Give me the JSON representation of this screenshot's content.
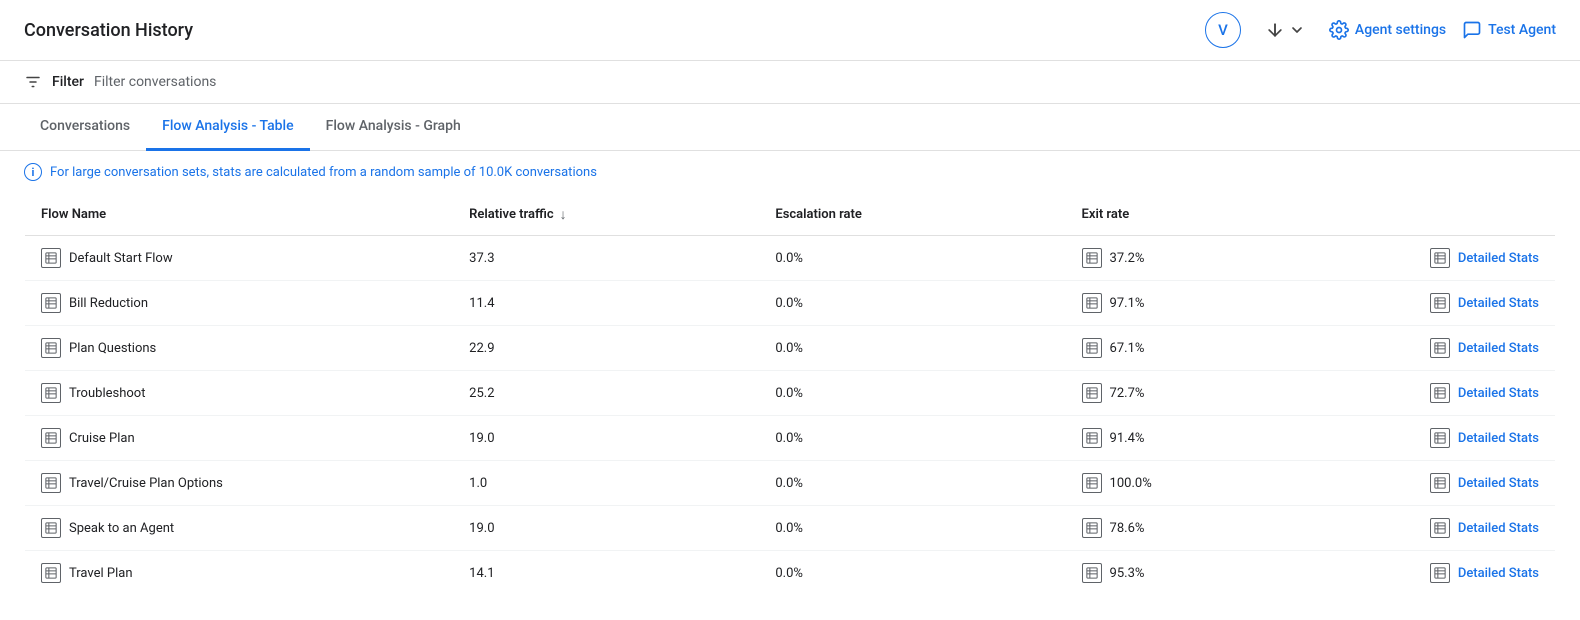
{
  "header": {
    "title": "Conversation History",
    "avatar_label": "V",
    "sort_label": "",
    "agent_settings_label": "Agent settings",
    "test_agent_label": "Test Agent"
  },
  "filter_bar": {
    "filter_label": "Filter",
    "filter_placeholder": "Filter conversations"
  },
  "tabs": [
    {
      "id": "conversations",
      "label": "Conversations",
      "active": false
    },
    {
      "id": "flow-table",
      "label": "Flow Analysis - Table",
      "active": true
    },
    {
      "id": "flow-graph",
      "label": "Flow Analysis - Graph",
      "active": false
    }
  ],
  "info_banner": {
    "text": "For large conversation sets, stats are calculated from a random sample of 10.0K conversations"
  },
  "table": {
    "columns": [
      {
        "id": "flow-name",
        "label": "Flow Name",
        "sortable": false
      },
      {
        "id": "relative-traffic",
        "label": "Relative traffic",
        "sortable": true
      },
      {
        "id": "escalation-rate",
        "label": "Escalation rate",
        "sortable": false
      },
      {
        "id": "exit-rate",
        "label": "Exit rate",
        "sortable": false
      },
      {
        "id": "action",
        "label": "",
        "sortable": false
      }
    ],
    "rows": [
      {
        "flow_name": "Default Start Flow",
        "relative_traffic": "37.3",
        "escalation_rate": "0.0%",
        "exit_rate": "37.2%",
        "action": "Detailed Stats"
      },
      {
        "flow_name": "Bill Reduction",
        "relative_traffic": "11.4",
        "escalation_rate": "0.0%",
        "exit_rate": "97.1%",
        "action": "Detailed Stats"
      },
      {
        "flow_name": "Plan Questions",
        "relative_traffic": "22.9",
        "escalation_rate": "0.0%",
        "exit_rate": "67.1%",
        "action": "Detailed Stats"
      },
      {
        "flow_name": "Troubleshoot",
        "relative_traffic": "25.2",
        "escalation_rate": "0.0%",
        "exit_rate": "72.7%",
        "action": "Detailed Stats"
      },
      {
        "flow_name": "Cruise Plan",
        "relative_traffic": "19.0",
        "escalation_rate": "0.0%",
        "exit_rate": "91.4%",
        "action": "Detailed Stats"
      },
      {
        "flow_name": "Travel/Cruise Plan Options",
        "relative_traffic": "1.0",
        "escalation_rate": "0.0%",
        "exit_rate": "100.0%",
        "action": "Detailed Stats"
      },
      {
        "flow_name": "Speak to an Agent",
        "relative_traffic": "19.0",
        "escalation_rate": "0.0%",
        "exit_rate": "78.6%",
        "action": "Detailed Stats"
      },
      {
        "flow_name": "Travel Plan",
        "relative_traffic": "14.1",
        "escalation_rate": "0.0%",
        "exit_rate": "95.3%",
        "action": "Detailed Stats"
      }
    ]
  },
  "icons": {
    "table_icon_char": "⊞",
    "info_char": "i",
    "filter_char": "≡",
    "sort_down_char": "↓",
    "chevron_char": "▾",
    "gear_char": "⚙",
    "chat_char": "💬"
  }
}
